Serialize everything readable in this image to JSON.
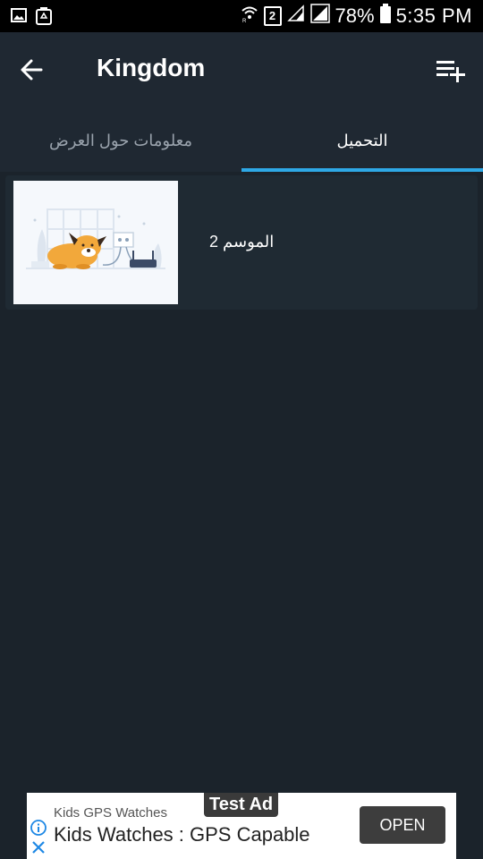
{
  "status_bar": {
    "battery": "78%",
    "time": "5:35 PM",
    "sim_badge": "2",
    "icons": [
      "image-icon",
      "recycle-icon",
      "wifi-icon",
      "sim-2-icon",
      "signal-icon",
      "signal-icon",
      "battery-icon"
    ]
  },
  "app_bar": {
    "title": "Kingdom",
    "icons": [
      "back-arrow-icon",
      "playlist-add-icon"
    ]
  },
  "tabs": [
    {
      "label": "معلومات حول العرض",
      "selected": false
    },
    {
      "label": "التحميل",
      "selected": true
    }
  ],
  "accent_color": "#2ea8e6",
  "seasons": [
    {
      "label": "الموسم 2"
    }
  ],
  "ad": {
    "tag": "Test Ad",
    "advertiser": "Kids GPS Watches",
    "headline": "Kids Watches : GPS Capable",
    "cta": "OPEN",
    "icons": [
      "info-icon",
      "close-icon"
    ]
  }
}
